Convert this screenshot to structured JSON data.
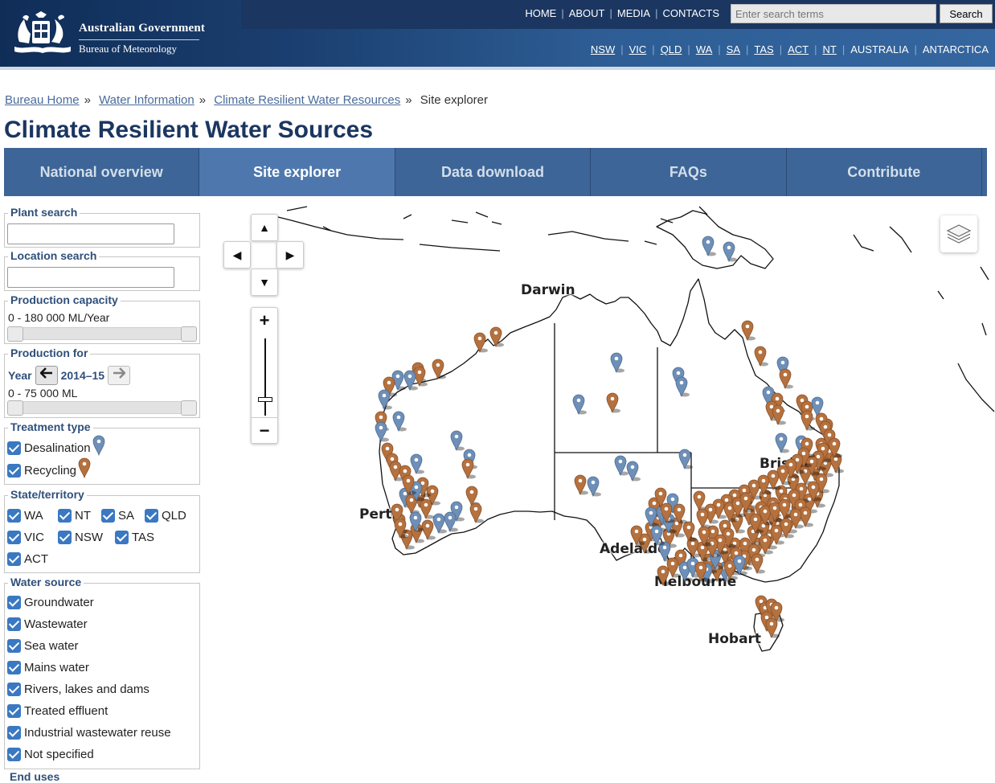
{
  "header": {
    "logo_line1": "Australian Government",
    "logo_line2": "Bureau of Meteorology",
    "top_links": [
      "HOME",
      "ABOUT",
      "MEDIA",
      "CONTACTS"
    ],
    "search_placeholder": "Enter search terms",
    "search_button": "Search",
    "state_links": [
      "NSW",
      "VIC",
      "QLD",
      "WA",
      "SA",
      "TAS",
      "ACT",
      "NT"
    ],
    "region_links": [
      "AUSTRALIA",
      "ANTARCTICA"
    ]
  },
  "breadcrumb": {
    "items": [
      "Bureau Home",
      "Water Information",
      "Climate Resilient Water Resources"
    ],
    "current": "Site explorer",
    "separator": "»"
  },
  "page_title": "Climate Resilient Water Sources",
  "tabs": {
    "items": [
      "National overview",
      "Site explorer",
      "Data download",
      "FAQs",
      "Contribute"
    ],
    "active": "Site explorer"
  },
  "sidebar": {
    "plant_search": {
      "legend": "Plant search",
      "value": ""
    },
    "location_search": {
      "legend": "Location search",
      "value": ""
    },
    "production_capacity": {
      "legend": "Production capacity",
      "range_text": "0 - 180 000 ML/Year"
    },
    "production_for": {
      "legend": "Production for",
      "year_label": "Year",
      "year_value": "2014–15",
      "range_text": "0 - 75 000 ML"
    },
    "treatment_type": {
      "legend": "Treatment type",
      "items": [
        "Desalination",
        "Recycling"
      ]
    },
    "state_territory": {
      "legend": "State/territory",
      "items": [
        "WA",
        "NT",
        "SA",
        "QLD",
        "VIC",
        "NSW",
        "TAS",
        "ACT"
      ]
    },
    "water_source": {
      "legend": "Water source",
      "items": [
        "Groundwater",
        "Wastewater",
        "Sea water",
        "Mains water",
        "Rivers, lakes and dams",
        "Treated effluent",
        "Industrial wastewater reuse",
        "Not specified"
      ]
    },
    "end_uses_legend": "End uses"
  },
  "map": {
    "cities": [
      "Darwin",
      "Brisbane",
      "Perth",
      "Adelaide",
      "Melbourne",
      "Hobart"
    ],
    "controls": {
      "up": "▲",
      "down": "▼",
      "left": "◀",
      "right": "▶",
      "zoom_in": "+",
      "zoom_out": "−"
    },
    "colors": {
      "desalination": "#6e8fb7",
      "recycling": "#b5713e",
      "checkbox": "#3a78c2",
      "header": "#1b3660"
    }
  }
}
